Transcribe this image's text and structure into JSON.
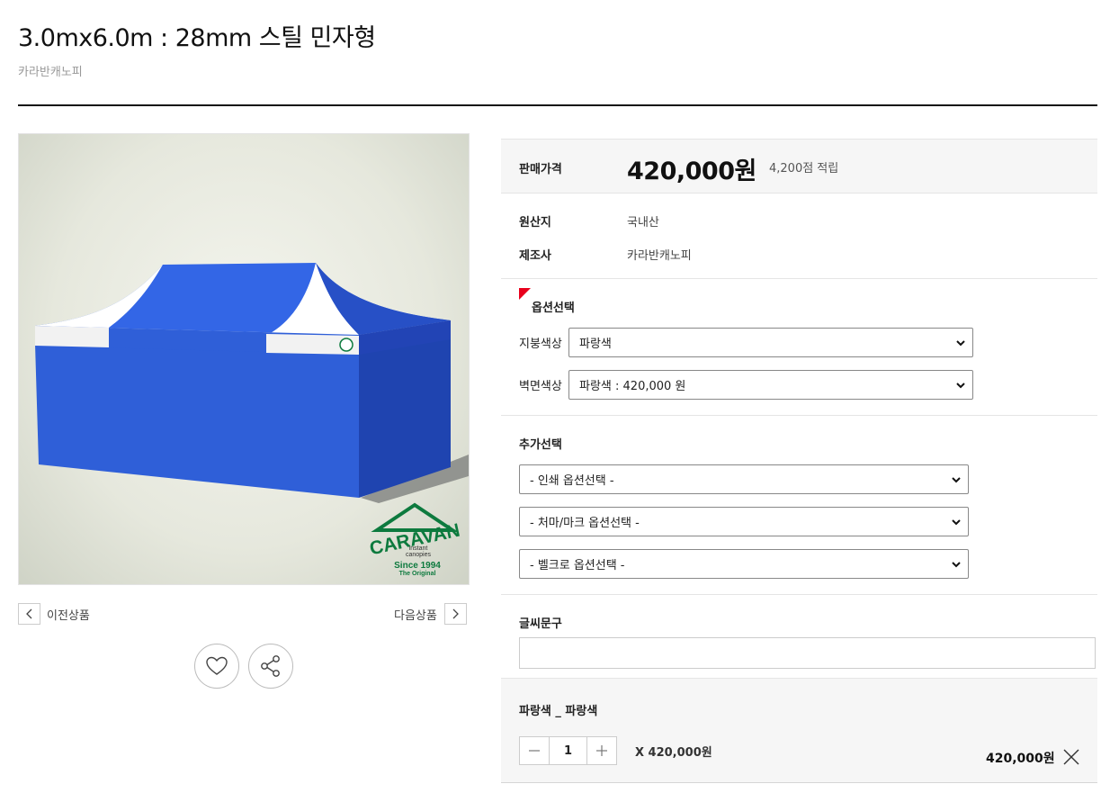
{
  "product": {
    "title": "3.0mx6.0m : 28mm 스틸 민자형",
    "brand": "카라반캐노피"
  },
  "image": {
    "logo_word": "CARAVAN",
    "logo_sub1": "instant",
    "logo_sub2": "canopies",
    "logo_since": "Since 1994",
    "logo_tag": "The Original"
  },
  "nav": {
    "prev_label": "이전상품",
    "next_label": "다음상품"
  },
  "price": {
    "label": "판매가격",
    "value": "420,000원",
    "points": "4,200점 적립"
  },
  "info": [
    {
      "label": "원산지",
      "value": "국내산"
    },
    {
      "label": "제조사",
      "value": "카라반캐노피"
    }
  ],
  "options": {
    "title": "옵션선택",
    "roof_label": "지붕색상",
    "roof_value": "파랑색",
    "wall_label": "벽면색상",
    "wall_value": "파랑색 : 420,000 원"
  },
  "extra": {
    "title": "추가선택",
    "print_value": "- 인쇄 옵션선택 -",
    "eave_value": "- 처마/마크 옵션선택 -",
    "velcro_value": "- 벨크로 옵션선택 -"
  },
  "text_field": {
    "title": "글씨문구",
    "value": ""
  },
  "cart": {
    "item_name": "파랑색 _ 파랑색",
    "quantity": "1",
    "unit_price": "X 420,000원",
    "total": "420,000원"
  },
  "colors": {
    "tent_blue": "#2f5fd8",
    "accent_red": "#e8001c",
    "logo_green": "#0d7a3e"
  }
}
